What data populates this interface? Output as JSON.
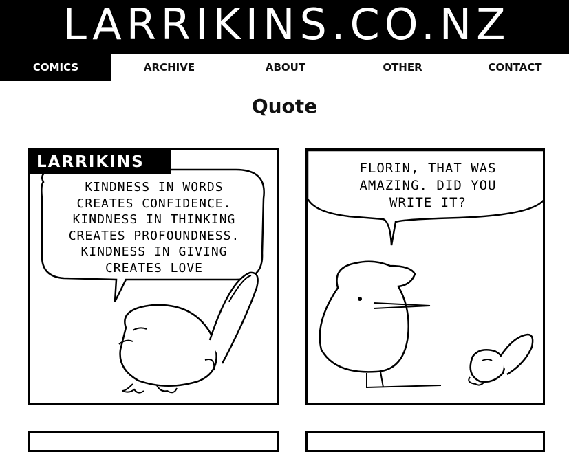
{
  "site": {
    "logo": "LARRIKINS.CO.NZ"
  },
  "nav": {
    "items": [
      {
        "label": "COMICS",
        "active": true
      },
      {
        "label": "ARCHIVE"
      },
      {
        "label": "ABOUT"
      },
      {
        "label": "OTHER"
      },
      {
        "label": "CONTACT"
      }
    ]
  },
  "page": {
    "title": "Quote"
  },
  "comic": {
    "panel1": {
      "brand": "LARRIKINS",
      "speech": [
        "KINDNESS IN WORDS",
        "CREATES CONFIDENCE.",
        "KINDNESS IN THINKING",
        "CREATES PROFOUNDNESS.",
        "KINDNESS IN GIVING",
        "CREATES LOVE"
      ]
    },
    "panel2": {
      "speech": [
        "FLORIN, THAT WAS",
        "AMAZING. DID YOU",
        "WRITE IT?"
      ]
    }
  },
  "colors": {
    "header_bg": "#000000",
    "text": "#111111",
    "background": "#ffffff"
  }
}
